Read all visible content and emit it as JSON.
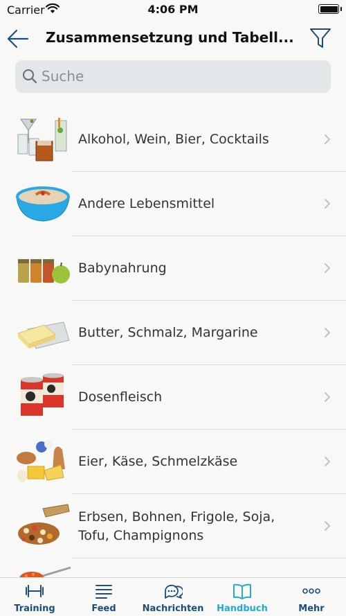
{
  "status_bar": {
    "carrier": "Carrier",
    "time": "4:06 PM"
  },
  "nav": {
    "title": "Zusammensetzung und Tabell...",
    "back_icon": "arrow-left-icon",
    "filter_icon": "filter-icon"
  },
  "search": {
    "placeholder": "Suche",
    "value": ""
  },
  "categories": [
    {
      "label": "Alkohol, Wein, Bier, Cocktails",
      "image": "drinks"
    },
    {
      "label": "Andere Lebensmittel",
      "image": "bowl"
    },
    {
      "label": "Babynahrung",
      "image": "jars"
    },
    {
      "label": "Butter, Schmalz, Margarine",
      "image": "butter"
    },
    {
      "label": "Dosenfleisch",
      "image": "cans"
    },
    {
      "label": "Eier, Käse, Schmelzkäse",
      "image": "dairy"
    },
    {
      "label": "Erbsen, Bohnen, Frigole, Soja, Tofu, Champignons",
      "image": "legumes"
    },
    {
      "label": "",
      "image": "caviar"
    }
  ],
  "tabs": [
    {
      "label": "Training",
      "icon": "dumbbell-icon",
      "active": false
    },
    {
      "label": "Feed",
      "icon": "list-lines-icon",
      "active": false
    },
    {
      "label": "Nachrichten",
      "icon": "chat-bubbles-icon",
      "active": false
    },
    {
      "label": "Handbuch",
      "icon": "open-book-icon",
      "active": true
    },
    {
      "label": "Mehr",
      "icon": "more-dots-icon",
      "active": false
    }
  ],
  "colors": {
    "accent": "#23a9d4",
    "nav_dark": "#1a4d7c",
    "background": "#f8f9f7"
  }
}
